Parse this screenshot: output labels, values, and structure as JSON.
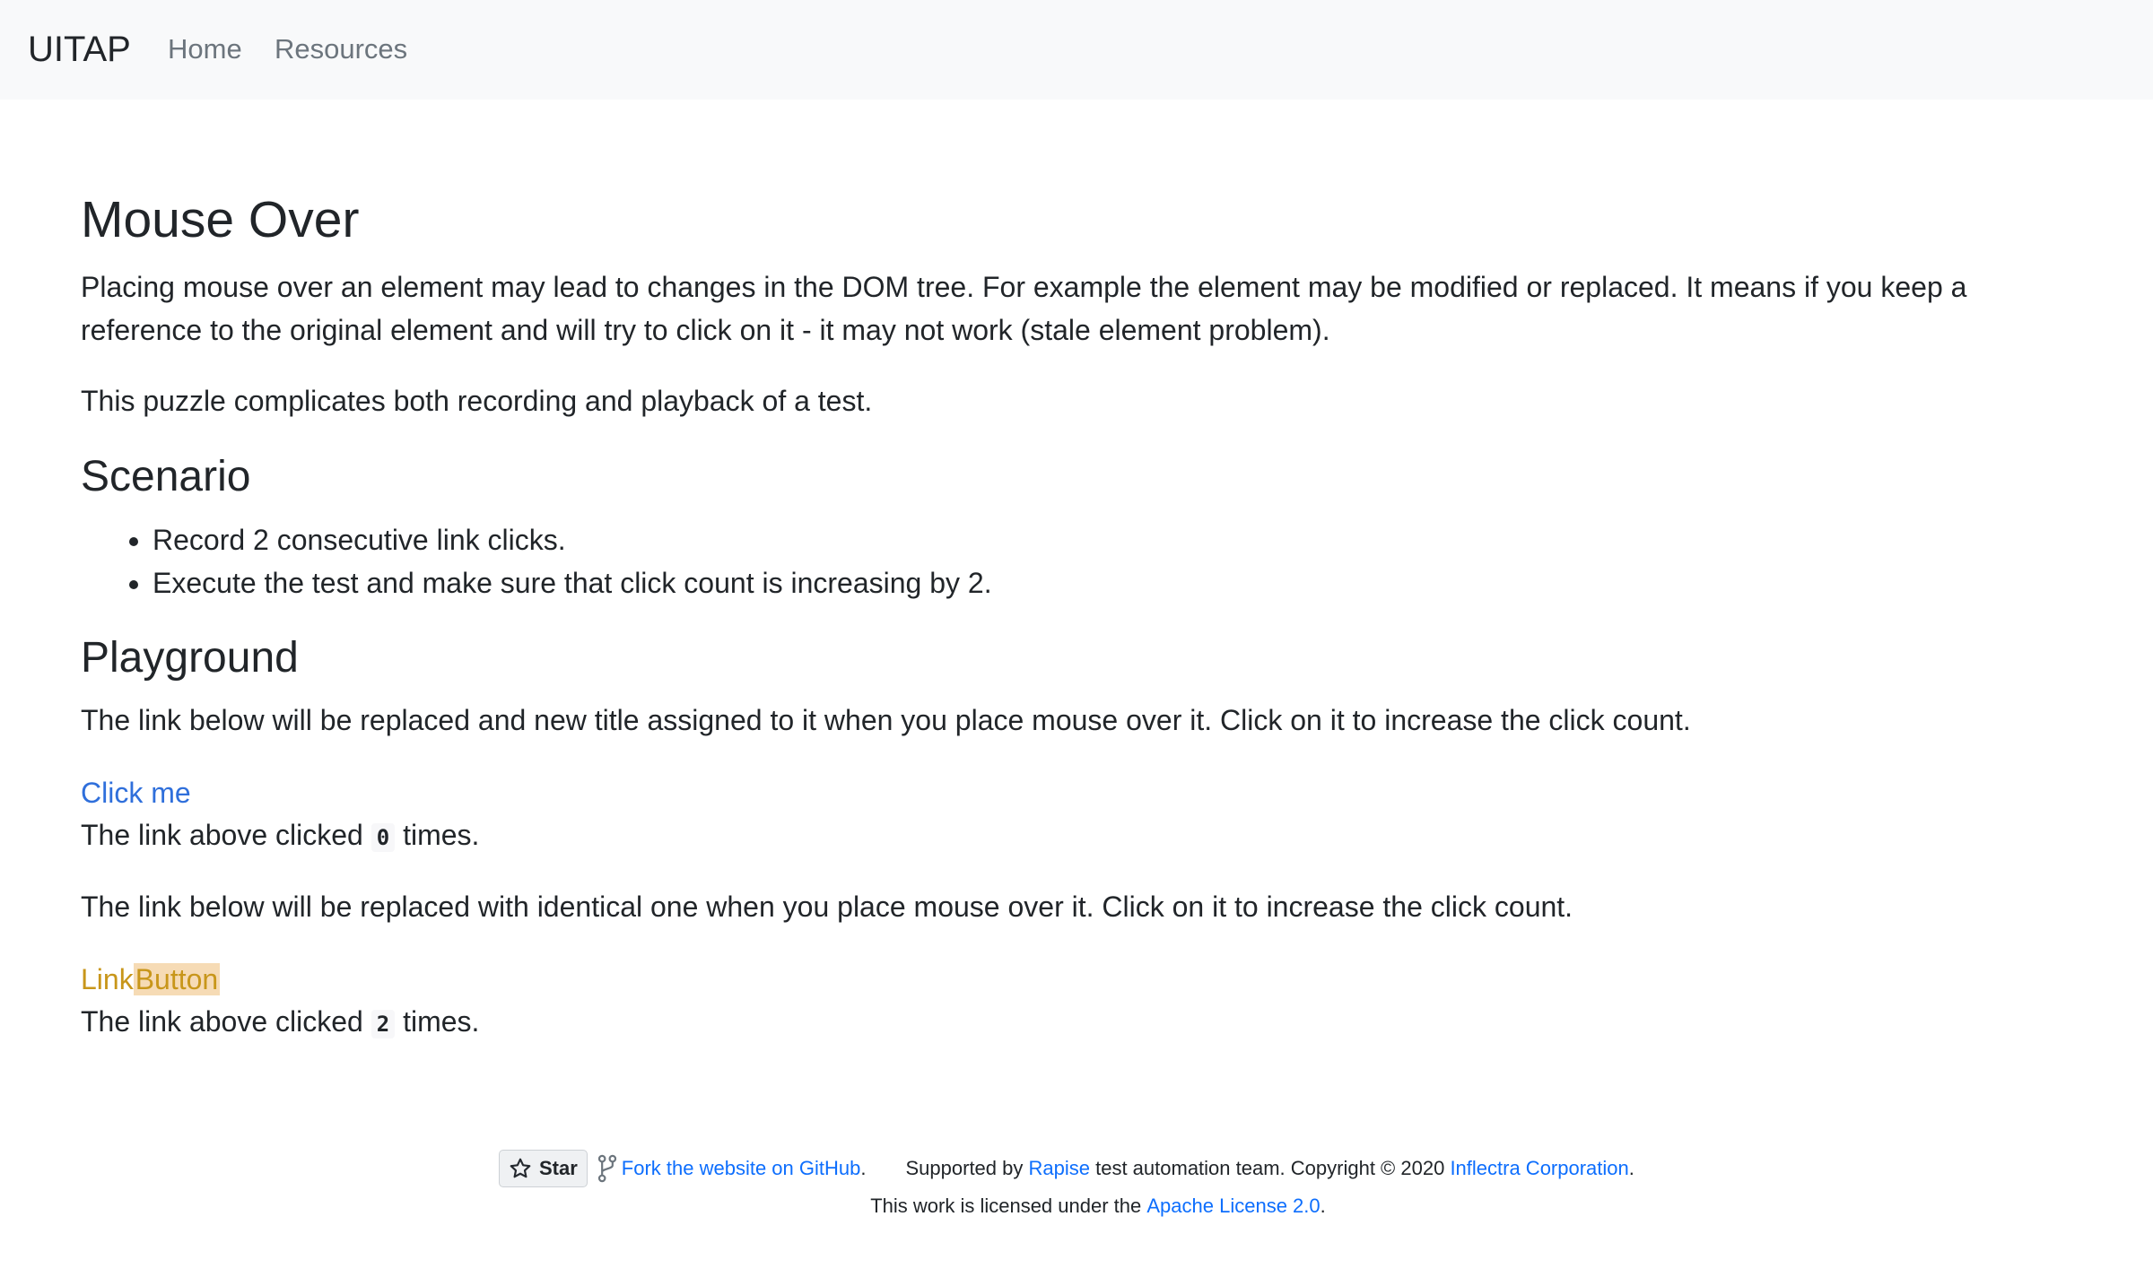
{
  "nav": {
    "brand": "UITAP",
    "links": [
      "Home",
      "Resources"
    ]
  },
  "page": {
    "title": "Mouse Over",
    "intro": "Placing mouse over an element may lead to changes in the DOM tree. For example the element may be modified or replaced. It means if you keep a reference to the original element and will try to click on it - it may not work (stale element problem).",
    "intro2": "This puzzle complicates both recording and playback of a test.",
    "scenario_heading": "Scenario",
    "scenario_items": [
      "Record 2 consecutive link clicks.",
      "Execute the test and make sure that click count is increasing by 2."
    ],
    "playground_heading": "Playground",
    "playground_text1": "The link below will be replaced and new title assigned to it when you place mouse over it. Click on it to increase the click count.",
    "link1_label": "Click me",
    "link1_count_prefix": "The link above clicked",
    "link1_count": "0",
    "link1_count_suffix": "times.",
    "playground_text2": "The link below will be replaced with identical one when you place mouse over it. Click on it to increase the click count.",
    "link2_label_part1": "Link",
    "link2_label_part2": "Button",
    "link2_count_prefix": "The link above clicked",
    "link2_count": "2",
    "link2_count_suffix": "times."
  },
  "footer": {
    "star_label": "Star",
    "fork_link": "Fork the website on GitHub",
    "fork_suffix": ".",
    "supported_prefix": "Supported by",
    "rapise_link": "Rapise",
    "supported_middle": "test automation team. Copyright © 2020",
    "inflectra_link": "Inflectra Corporation",
    "supported_suffix": ".",
    "license_prefix": "This work is licensed under the",
    "license_link": "Apache License 2.0",
    "license_suffix": "."
  },
  "colors": {
    "link_blue": "#0d6efd",
    "link_button_text": "#c8961a",
    "link_button_highlight": "#f6dbb5",
    "navbar_bg": "#f8f9fa"
  }
}
